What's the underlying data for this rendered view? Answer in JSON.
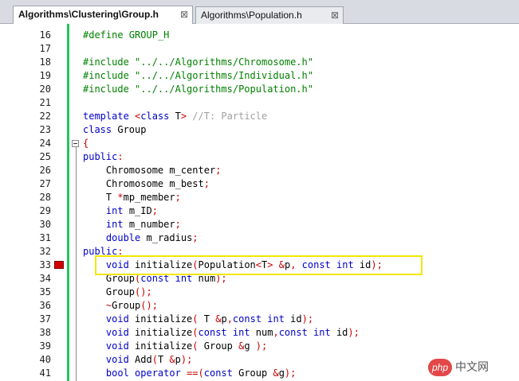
{
  "tabs": [
    {
      "label": "Algorithms\\Clustering\\Group.h",
      "active": true
    },
    {
      "label": "Algorithms\\Population.h",
      "active": false
    }
  ],
  "tab_close_glyph": "⊠",
  "colors": {
    "keyword": "#0000c8",
    "preprocessor": "#008000",
    "comment": "#a0a0a0",
    "operator": "#c80000",
    "change_bar": "#22c55e",
    "breakpoint": "#d10000",
    "highlight_box": "#f2e600"
  },
  "editor": {
    "first_line_number": 16,
    "breakpoint_line": 33,
    "highlighted_line": 33,
    "fold_start_line": 24,
    "lines": [
      [
        [
          "#define GROUP_H",
          "pp"
        ]
      ],
      [],
      [
        [
          "#include \"../../Algorithms/Chromosome.h\"",
          "pp"
        ]
      ],
      [
        [
          "#include \"../../Algorithms/Individual.h\"",
          "pp"
        ]
      ],
      [
        [
          "#include \"../../Algorithms/Population.h\"",
          "pp"
        ]
      ],
      [],
      [
        [
          "template ",
          "kw"
        ],
        [
          "<",
          "op"
        ],
        [
          "class",
          "kw"
        ],
        [
          " T",
          "t"
        ],
        [
          ">",
          "op"
        ],
        [
          " //T: Particle",
          "cm"
        ]
      ],
      [
        [
          "class",
          "kw"
        ],
        [
          " Group",
          "t"
        ]
      ],
      [
        [
          "{",
          "op"
        ]
      ],
      [
        [
          "public",
          "kw"
        ],
        [
          ":",
          "op"
        ]
      ],
      [
        [
          "    Chromosome m_center",
          "t"
        ],
        [
          ";",
          "op"
        ]
      ],
      [
        [
          "    Chromosome m_best",
          "t"
        ],
        [
          ";",
          "op"
        ]
      ],
      [
        [
          "    T ",
          "t"
        ],
        [
          "*",
          "op"
        ],
        [
          "mp_member",
          "t"
        ],
        [
          ";",
          "op"
        ]
      ],
      [
        [
          "    ",
          "t"
        ],
        [
          "int",
          "kw"
        ],
        [
          " m_ID",
          "t"
        ],
        [
          ";",
          "op"
        ]
      ],
      [
        [
          "    ",
          "t"
        ],
        [
          "int",
          "kw"
        ],
        [
          " m_number",
          "t"
        ],
        [
          ";",
          "op"
        ]
      ],
      [
        [
          "    ",
          "t"
        ],
        [
          "double",
          "kw"
        ],
        [
          " m_radius",
          "t"
        ],
        [
          ";",
          "op"
        ]
      ],
      [
        [
          "public",
          "kw"
        ],
        [
          ":",
          "op"
        ]
      ],
      [
        [
          "    ",
          "t"
        ],
        [
          "void",
          "kw"
        ],
        [
          " initialize",
          "t"
        ],
        [
          "(",
          "op"
        ],
        [
          "Population",
          "t"
        ],
        [
          "<",
          "op"
        ],
        [
          "T",
          "t"
        ],
        [
          ">",
          "op"
        ],
        [
          " ",
          "t"
        ],
        [
          "&",
          "op"
        ],
        [
          "p",
          "t"
        ],
        [
          ",",
          "op"
        ],
        [
          " ",
          "t"
        ],
        [
          "const int",
          "kw"
        ],
        [
          " id",
          "t"
        ],
        [
          ");",
          "op"
        ]
      ],
      [
        [
          "    Group",
          "t"
        ],
        [
          "(",
          "op"
        ],
        [
          "const int",
          "kw"
        ],
        [
          " num",
          "t"
        ],
        [
          ");",
          "op"
        ]
      ],
      [
        [
          "    Group",
          "t"
        ],
        [
          "();",
          "op"
        ]
      ],
      [
        [
          "    ",
          "t"
        ],
        [
          "~",
          "op"
        ],
        [
          "Group",
          "t"
        ],
        [
          "();",
          "op"
        ]
      ],
      [
        [
          "    ",
          "t"
        ],
        [
          "void",
          "kw"
        ],
        [
          " initialize",
          "t"
        ],
        [
          "(",
          "op"
        ],
        [
          " T ",
          "t"
        ],
        [
          "&",
          "op"
        ],
        [
          "p",
          "t"
        ],
        [
          ",",
          "op"
        ],
        [
          "const int",
          "kw"
        ],
        [
          " id",
          "t"
        ],
        [
          ");",
          "op"
        ]
      ],
      [
        [
          "    ",
          "t"
        ],
        [
          "void",
          "kw"
        ],
        [
          " initialize",
          "t"
        ],
        [
          "(",
          "op"
        ],
        [
          "const int",
          "kw"
        ],
        [
          " num",
          "t"
        ],
        [
          ",",
          "op"
        ],
        [
          "const int",
          "kw"
        ],
        [
          " id",
          "t"
        ],
        [
          ");",
          "op"
        ]
      ],
      [
        [
          "    ",
          "t"
        ],
        [
          "void",
          "kw"
        ],
        [
          " initialize",
          "t"
        ],
        [
          "(",
          "op"
        ],
        [
          " Group ",
          "t"
        ],
        [
          "&",
          "op"
        ],
        [
          "g ",
          "t"
        ],
        [
          ");",
          "op"
        ]
      ],
      [
        [
          "    ",
          "t"
        ],
        [
          "void",
          "kw"
        ],
        [
          " Add",
          "t"
        ],
        [
          "(",
          "op"
        ],
        [
          "T ",
          "t"
        ],
        [
          "&",
          "op"
        ],
        [
          "p",
          "t"
        ],
        [
          ");",
          "op"
        ]
      ],
      [
        [
          "    ",
          "t"
        ],
        [
          "bool operator",
          "kw"
        ],
        [
          " ",
          "t"
        ],
        [
          "==(",
          "op"
        ],
        [
          "const",
          "kw"
        ],
        [
          " Group ",
          "t"
        ],
        [
          "&",
          "op"
        ],
        [
          "g",
          "t"
        ],
        [
          ");",
          "op"
        ]
      ]
    ]
  },
  "watermark": {
    "logo_text": "php",
    "site_text": "中文网"
  }
}
